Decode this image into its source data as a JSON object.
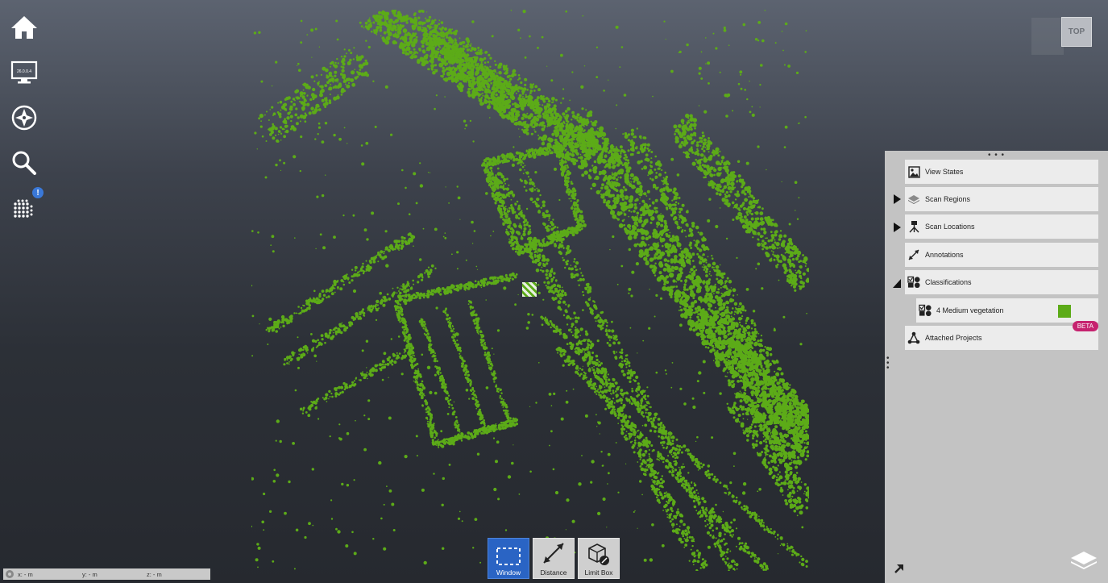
{
  "left_toolbar": [
    {
      "name": "home-icon"
    },
    {
      "name": "display-settings-icon",
      "screen_text": "26.0.0.4"
    },
    {
      "name": "compass-icon"
    },
    {
      "name": "search-icon"
    },
    {
      "name": "point-cloud-icon",
      "badge": "!"
    }
  ],
  "view_cube": {
    "label": "TOP"
  },
  "panel": {
    "items": [
      {
        "label": "View States",
        "icon": "image-icon",
        "expander": ""
      },
      {
        "label": "Scan Regions",
        "icon": "layers-icon",
        "expander": "collapsed"
      },
      {
        "label": "Scan Locations",
        "icon": "tripod-icon",
        "expander": "collapsed"
      },
      {
        "label": "Annotations",
        "icon": "measure-icon",
        "expander": ""
      },
      {
        "label": "Classifications",
        "icon": "shapes-icon",
        "expander": "expanded"
      }
    ],
    "classification_item": {
      "label": "4 Medium vegetation",
      "color": "#5cab18"
    },
    "attached": {
      "label": "Attached Projects",
      "badge": "BETA"
    }
  },
  "tools": [
    {
      "label": "Window",
      "active": true
    },
    {
      "label": "Distance",
      "active": false
    },
    {
      "label": "Limit Box",
      "active": false
    }
  ],
  "coords": {
    "x": "x:  - m",
    "y": "y:  - m",
    "z": "z:  - m"
  },
  "colors": {
    "point_cloud": "#5cab18",
    "active_tool": "#2a64c4",
    "beta": "#c6236f"
  }
}
